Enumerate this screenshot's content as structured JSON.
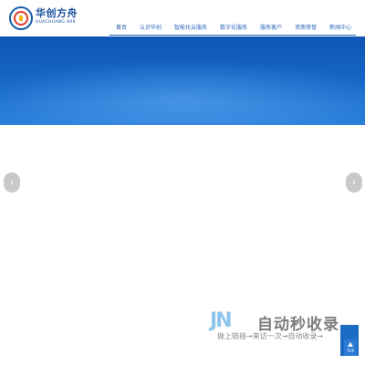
{
  "header": {
    "logo": {
      "name_cn": "华创方舟",
      "name_en": "HUACHUANG ARK"
    },
    "nav": {
      "items": [
        {
          "label": "首页"
        },
        {
          "label": "认识华创"
        },
        {
          "label": "智能化云服务"
        },
        {
          "label": "数字化服务"
        },
        {
          "label": "服务客户"
        },
        {
          "label": "资质荣誉"
        },
        {
          "label": "新闻中心"
        }
      ]
    }
  },
  "banner": {
    "prev_icon": "‹",
    "next_icon": "›"
  },
  "watermark": {
    "brand": "JN",
    "title": "自动秒收录",
    "subtitle": "做上链接→来访一次→自动收录→"
  },
  "side": {
    "top_label": "TOP"
  },
  "colors": {
    "nav_text": "#2b66b8",
    "banner": "#1567c8",
    "side": "#1c6cc4"
  }
}
